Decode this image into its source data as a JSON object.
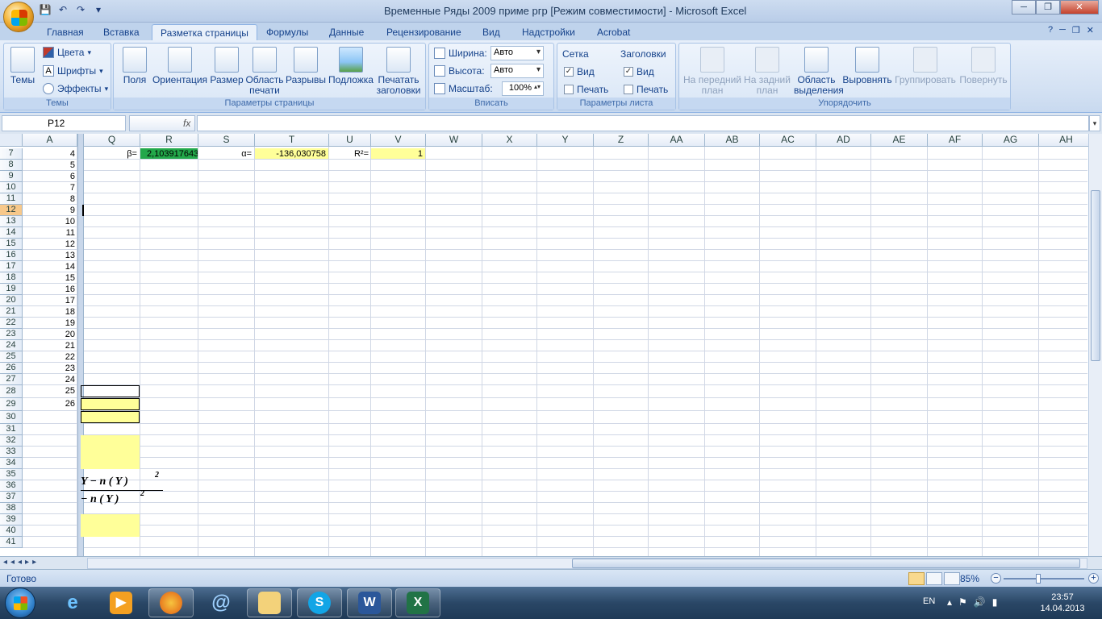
{
  "window": {
    "title": "Временные Ряды 2009 приме ргр  [Режим совместимости] - Microsoft Excel",
    "minimize_icon": "─",
    "maximize_icon": "❐",
    "close_icon": "✕"
  },
  "qat": {
    "save_icon": "💾",
    "undo_icon": "↶",
    "redo_icon": "↷",
    "customize_icon": "▾"
  },
  "tabs": [
    {
      "label": "Главная"
    },
    {
      "label": "Вставка"
    },
    {
      "label": "Разметка страницы",
      "active": true
    },
    {
      "label": "Формулы"
    },
    {
      "label": "Данные"
    },
    {
      "label": "Рецензирование"
    },
    {
      "label": "Вид"
    },
    {
      "label": "Надстройки"
    },
    {
      "label": "Acrobat"
    }
  ],
  "ribbon_help": {
    "help": "?",
    "min": "─",
    "restore": "❐",
    "close": "✕"
  },
  "ribbon": {
    "themes": {
      "label": "Темы",
      "themes_btn": "Темы",
      "colors": "Цвета",
      "fonts": "Шрифты",
      "effects": "Эффекты"
    },
    "page_setup": {
      "label": "Параметры страницы",
      "margins": "Поля",
      "orientation": "Ориентация",
      "size": "Размер",
      "print_area_1": "Область",
      "print_area_2": "печати",
      "breaks": "Разрывы",
      "background": "Подложка",
      "print_titles_1": "Печатать",
      "print_titles_2": "заголовки"
    },
    "scale": {
      "label": "Вписать",
      "width_label": "Ширина:",
      "width_value": "Авто",
      "height_label": "Высота:",
      "height_value": "Авто",
      "scale_label": "Масштаб:",
      "scale_value": "100%"
    },
    "sheet_options": {
      "label": "Параметры листа",
      "gridlines": "Сетка",
      "headings": "Заголовки",
      "view": "Вид",
      "print": "Печать",
      "grid_view_checked": true,
      "grid_print_checked": false,
      "head_view_checked": true,
      "head_print_checked": false
    },
    "arrange": {
      "label": "Упорядочить",
      "bring_front_1": "На передний",
      "bring_front_2": "план",
      "send_back_1": "На задний",
      "send_back_2": "план",
      "selection_1": "Область",
      "selection_2": "выделения",
      "align": "Выровнять",
      "group": "Группировать",
      "rotate": "Повернуть"
    }
  },
  "formula_bar": {
    "name_box": "P12",
    "fx": "fx",
    "formula": ""
  },
  "columns": [
    "A",
    "Q",
    "R",
    "S",
    "T",
    "U",
    "V",
    "W",
    "X",
    "Y",
    "Z",
    "AA",
    "AB",
    "AC",
    "AD",
    "AE",
    "AF",
    "AG",
    "AH"
  ],
  "rows": [
    "7",
    "8",
    "9",
    "10",
    "11",
    "12",
    "13",
    "14",
    "15",
    "16",
    "17",
    "18",
    "19",
    "20",
    "21",
    "22",
    "23",
    "24",
    "25",
    "26",
    "27",
    "28",
    "29",
    "30",
    "31",
    "32",
    "33",
    "34",
    "35",
    "36",
    "37",
    "38",
    "39",
    "40",
    "41"
  ],
  "selected_row": "12",
  "colA_values": [
    "4",
    "5",
    "6",
    "7",
    "8",
    "9",
    "10",
    "11",
    "12",
    "13",
    "14",
    "15",
    "16",
    "17",
    "18",
    "19",
    "20",
    "21",
    "22",
    "23",
    "24",
    "25",
    "26"
  ],
  "cells": {
    "beta_label": "β=",
    "beta_value": "2,103917643",
    "alpha_label": "α=",
    "alpha_value": "-136,030758",
    "r2_label": "R²=",
    "r2_value": "1"
  },
  "formula_image": {
    "line1": "Y  − n ( Y )",
    "line2": "− n ( Y )",
    "exp": "2"
  },
  "status": {
    "ready": "Готово",
    "zoom": "85%",
    "zoom_minus": "−",
    "zoom_plus": "+"
  },
  "taskbar": {
    "lang": "EN",
    "time": "23:57",
    "date": "14.04.2013"
  },
  "colors": {
    "green_fill": "#22a84a",
    "yellow_fill": "#ffff99",
    "selected_row_header": "#f7c88a"
  }
}
